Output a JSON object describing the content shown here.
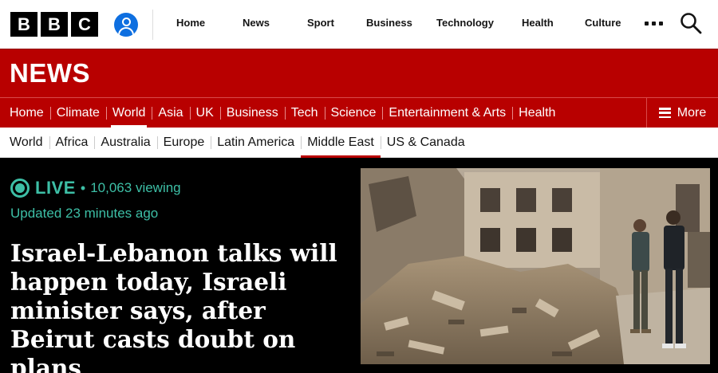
{
  "masthead": {
    "logo_letters": [
      "B",
      "B",
      "C"
    ],
    "nav": [
      "Home",
      "News",
      "Sport",
      "Business",
      "Technology",
      "Health",
      "Culture"
    ],
    "more_icon": "more-dots-icon",
    "search_icon": "search-icon",
    "account_icon": "account-icon"
  },
  "banner": {
    "title": "NEWS",
    "color": "#b80000"
  },
  "primary_nav": {
    "items": [
      "Home",
      "Climate",
      "World",
      "Asia",
      "UK",
      "Business",
      "Tech",
      "Science",
      "Entertainment & Arts",
      "Health"
    ],
    "active": "World",
    "more_label": "More"
  },
  "secondary_nav": {
    "items": [
      "World",
      "Africa",
      "Australia",
      "Europe",
      "Latin America",
      "Middle East",
      "US & Canada"
    ],
    "active": "Middle East"
  },
  "hero": {
    "live_label": "LIVE",
    "separator": "•",
    "viewing": "10,063 viewing",
    "updated": "Updated 23 minutes ago",
    "headline": "Israel-Lebanon talks will happen today, Israeli minister says, after Beirut casts doubt on plans",
    "accent_color": "#3dbfa6"
  }
}
